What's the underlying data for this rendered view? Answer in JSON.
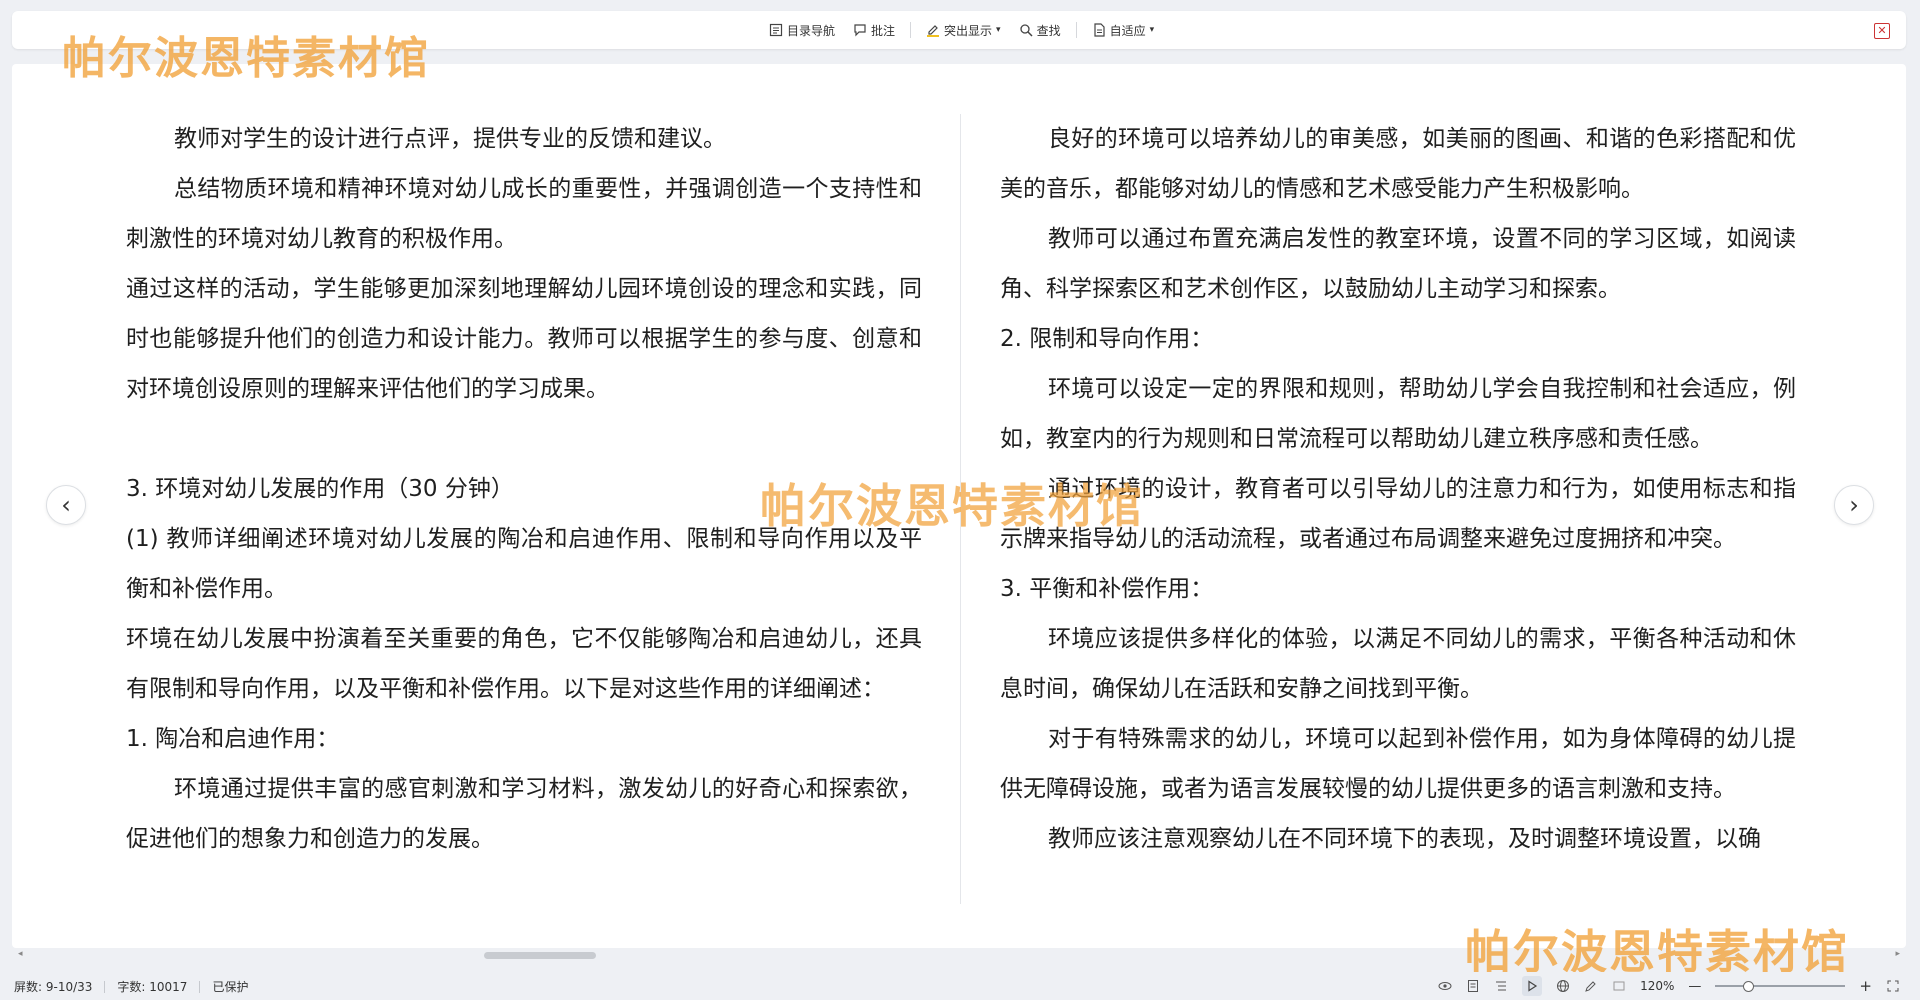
{
  "toolbar": {
    "items": [
      {
        "label": "目录导航",
        "icon": "toc-icon"
      },
      {
        "label": "批注",
        "icon": "comment-icon"
      },
      {
        "label": "突出显示",
        "icon": "highlight-icon"
      },
      {
        "label": "查找",
        "icon": "search-icon"
      },
      {
        "label": "自适应",
        "icon": "fit-page-icon"
      }
    ],
    "close_icon": "close-icon"
  },
  "watermark": {
    "text": "帕尔波恩特素材馆"
  },
  "document": {
    "left_column": [
      {
        "text": "教师对学生的设计进行点评，提供专业的反馈和建议。",
        "indent": true
      },
      {
        "text": "总结物质环境和精神环境对幼儿成长的重要性，并强调创造一个支持性和刺激性的环境对幼儿教育的积极作用。",
        "indent": true
      },
      {
        "text": "通过这样的活动，学生能够更加深刻地理解幼儿园环境创设的理念和实践，同时也能够提升他们的创造力和设计能力。教师可以根据学生的参与度、创意和对环境创设原则的理解来评估他们的学习成果。",
        "indent": false
      },
      {
        "text": "",
        "indent": false
      },
      {
        "text": "3.  环境对幼儿发展的作用（30 分钟）",
        "indent": false
      },
      {
        "text": "(1)  教师详细阐述环境对幼儿发展的陶冶和启迪作用、限制和导向作用以及平衡和补偿作用。",
        "indent": false
      },
      {
        "text": "环境在幼儿发展中扮演着至关重要的角色，它不仅能够陶冶和启迪幼儿，还具有限制和导向作用，以及平衡和补偿作用。以下是对这些作用的详细阐述：",
        "indent": false
      },
      {
        "text": "1.  陶冶和启迪作用：",
        "indent": false
      },
      {
        "text": "环境通过提供丰富的感官刺激和学习材料，激发幼儿的好奇心和探索欲，促进他们的想象力和创造力的发展。",
        "indent": true
      }
    ],
    "right_column": [
      {
        "text": "良好的环境可以培养幼儿的审美感，如美丽的图画、和谐的色彩搭配和优美的音乐，都能够对幼儿的情感和艺术感受能力产生积极影响。",
        "indent": true
      },
      {
        "text": "教师可以通过布置充满启发性的教室环境，设置不同的学习区域，如阅读角、科学探索区和艺术创作区，以鼓励幼儿主动学习和探索。",
        "indent": true
      },
      {
        "text": "2.  限制和导向作用：",
        "indent": false
      },
      {
        "text": "环境可以设定一定的界限和规则，帮助幼儿学会自我控制和社会适应，例如，教室内的行为规则和日常流程可以帮助幼儿建立秩序感和责任感。",
        "indent": true
      },
      {
        "text": "通过环境的设计，教育者可以引导幼儿的注意力和行为，如使用标志和指示牌来指导幼儿的活动流程，或者通过布局调整来避免过度拥挤和冲突。",
        "indent": true
      },
      {
        "text": "3.  平衡和补偿作用：",
        "indent": false
      },
      {
        "text": "环境应该提供多样化的体验，以满足不同幼儿的需求，平衡各种活动和休息时间，确保幼儿在活跃和安静之间找到平衡。",
        "indent": true
      },
      {
        "text": "对于有特殊需求的幼儿，环境可以起到补偿作用，如为身体障碍的幼儿提供无障碍设施，或者为语言发展较慢的幼儿提供更多的语言刺激和支持。",
        "indent": true
      },
      {
        "text": "教师应该注意观察幼儿在不同环境下的表现，及时调整环境设置，以确",
        "indent": true
      }
    ]
  },
  "status": {
    "screen": "屏数: 9-10/33",
    "words": "字数: 10017",
    "protected": "已保护",
    "zoom": "120%",
    "zoom_out": "—",
    "zoom_in": "+"
  },
  "nav": {
    "prev": "‹",
    "next": "›"
  },
  "colors": {
    "watermark": "#f2a23a",
    "background": "#eef0f4",
    "page": "#ffffff"
  }
}
